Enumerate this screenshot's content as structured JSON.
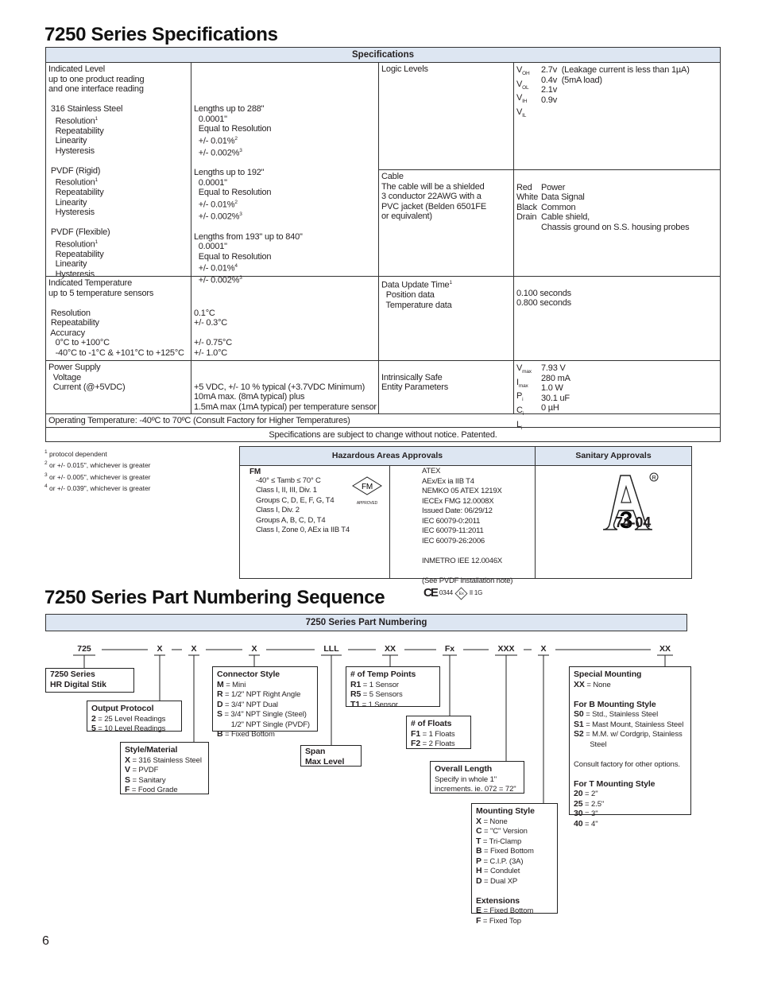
{
  "spec_title": "7250 Series Specifications",
  "spec_header": "Specifications",
  "level_label": [
    "Indicated Level",
    "up to one product reading",
    "and one interface reading",
    "",
    " 316 Stainless Steel",
    {
      "t": "   Resolution",
      "sup": "1"
    },
    "   Repeatability",
    "   Linearity",
    "   Hysteresis",
    "",
    " PVDF (Rigid)",
    {
      "t": "   Resolution",
      "sup": "1"
    },
    "   Repeatability",
    "   Linearity",
    "   Hysteresis",
    "",
    " PVDF (Flexible)",
    {
      "t": "   Resolution",
      "sup": "1"
    },
    "   Repeatability",
    "   Linearity",
    "   Hysteresis"
  ],
  "level_value": [
    "",
    "",
    "",
    "",
    "Lengths up to 288\"",
    "  0.0001\"",
    "  Equal to Resolution",
    {
      "t": "  +/- 0.01%",
      "sup": "2"
    },
    {
      "t": "  +/- 0.002%",
      "sup": "3"
    },
    "",
    "Lengths up to 192\"",
    "  0.0001\"",
    "  Equal to Resolution",
    {
      "t": "  +/- 0.01%",
      "sup": "2"
    },
    {
      "t": "  +/- 0.002%",
      "sup": "3"
    },
    "",
    "Lengths from 193\" up to 840\"",
    "  0.0001\"",
    "  Equal to Resolution",
    {
      "t": "  +/- 0.01%",
      "sup": "4"
    },
    {
      "t": "  +/- 0.002%",
      "sup": "3"
    }
  ],
  "temp_label": [
    "Indicated Temperature",
    "up to 5 temperature sensors",
    "",
    " Resolution",
    " Repeatability",
    " Accuracy",
    "   0°C to +100°C",
    "   -40°C to -1°C & +101°C to +125°C"
  ],
  "temp_value": [
    "",
    "",
    "",
    "0.1°C",
    "+/- 0.3°C",
    "",
    "+/- 0.75°C",
    "+/- 1.0°C"
  ],
  "power_label": [
    "Power Supply",
    "  Voltage",
    "  Current (@+5VDC)"
  ],
  "power_value": [
    "",
    "+5 VDC, +/- 10 % typical (+3.7VDC Minimum)",
    "10mA max. (8mA typical) plus",
    "1.5mA max (1mA typical) per temperature sensor"
  ],
  "logic_label": [
    "Logic Levels"
  ],
  "logic_sym": [
    {
      "t": "V",
      "sub": "OH"
    },
    {
      "t": "V",
      "sub": "OL"
    },
    {
      "t": "V",
      "sub": "IH"
    },
    {
      "t": "V",
      "sub": "IL"
    }
  ],
  "logic_value": [
    "2.7v  (Leakage current is less than 1µA)",
    "0.4v  (5mA load)",
    "2.1v",
    "0.9v"
  ],
  "cable_label": [
    "Cable",
    "The cable will be a shielded",
    "3 conductor 22AWG with a",
    "PVC jacket (Belden 6501FE",
    "or equivalent)"
  ],
  "cable_color": [
    "",
    "Red",
    "White",
    "Black",
    "Drain"
  ],
  "cable_value": [
    "",
    "Power",
    "Data Signal",
    "Common",
    "Cable shield,",
    "Chassis ground on S.S. housing probes"
  ],
  "update_label": [
    {
      "t": "Data Update Time",
      "sup": "1"
    },
    "  Position data",
    "  Temperature data"
  ],
  "update_value": [
    "",
    "0.100 seconds",
    "0.800 seconds"
  ],
  "is_label": [
    "",
    "Intrinsically Safe",
    "Entity Parameters"
  ],
  "is_sym": [
    {
      "t": "V",
      "sub": "max"
    },
    {
      "t": "I",
      "sub": "max"
    },
    {
      "t": "P",
      "sub": "i"
    },
    {
      "t": "C",
      "sub": "i"
    },
    {
      "t": "L",
      "sub": "i"
    }
  ],
  "is_value": [
    "7.93 V",
    "280 mA",
    "1.0 W",
    "30.1 uF",
    "0 µH"
  ],
  "operating_temp": "Operating Temperature: -40ºC  to 70ºC (Consult Factory for Higher Temperatures)",
  "notice": "Specifications are subject to change without notice. Patented.",
  "footnotes": [
    {
      "t": "protocol dependent",
      "n": "1"
    },
    {
      "t": "or +/- 0.015\", whichever is greater",
      "n": "2"
    },
    {
      "t": "or +/- 0.005\", whichever is greater",
      "n": "3"
    },
    {
      "t": "or +/- 0.039\", whichever is greater",
      "n": "4"
    }
  ],
  "approvals": {
    "hazardous_header": "Hazardous Areas Approvals",
    "sanitary_header": "Sanitary Approvals",
    "fm_title": "FM",
    "fm_lines": [
      "-40° ≤ Tamb ≤ 70° C",
      "Class I, II, III, Div. 1",
      "Groups C, D, E, F, G, T4",
      "Class I, Div. 2",
      "Groups A, B, C, D, T4",
      "Class I, Zone 0, AEx ia IIB T4"
    ],
    "fm_logo_text": "FM",
    "fm_logo_sub": "APPROVED",
    "atex_lines": [
      "ATEX",
      "AEx/Ex ia IIB T4",
      "NEMKO 05 ATEX 1219X",
      "IECEx FMG 12.0008X",
      "Issued Date: 06/29/12",
      "IEC 60079-0:2011",
      "IEC 60079-11:2011",
      "IEC 60079-26:2006",
      "",
      "INMETRO IEE 12.0046X",
      "",
      "(See PVDF installation note)"
    ],
    "ce_mark": "CE",
    "ce_number": "0344",
    "ex_mark": "Ex",
    "ex_class": "II 1G",
    "three_a_number": "74-04",
    "three_a_mark": "3"
  },
  "pn_title": "7250 Series Part Numbering Sequence",
  "pn_header": "7250 Series Part Numbering",
  "codes": [
    "725",
    "X",
    "X",
    "X",
    "LLL",
    "XX",
    "Fx",
    "XXX",
    "X",
    "XX"
  ],
  "boxes": {
    "series": [
      {
        "k": "7250 Series"
      },
      {
        "k": "HR Digital Stik"
      }
    ],
    "output": [
      {
        "k": "Output Protocol"
      },
      {
        "k": "2",
        "v": " = 25 Level Readings"
      },
      {
        "k": "5",
        "v": " = 10 Level Readings"
      }
    ],
    "style": [
      {
        "k": "Style/Material"
      },
      {
        "k": "X",
        "v": " = 316 Stainless Steel"
      },
      {
        "k": "V",
        "v": " = PVDF"
      },
      {
        "k": "S",
        "v": " = Sanitary"
      },
      {
        "k": "F",
        "v": " = Food Grade"
      }
    ],
    "connector": [
      {
        "k": "Connector Style"
      },
      {
        "k": "M",
        "v": " = Mini"
      },
      {
        "k": "R",
        "v": " = 1/2\" NPT Right Angle"
      },
      {
        "k": "D",
        "v": " = 3/4\" NPT Dual"
      },
      {
        "k": "S",
        "v": " = 3/4\" NPT Single (Steel)"
      },
      {
        "v": "       1/2\" NPT Single (PVDF)"
      },
      {
        "k": "B",
        "v": " = Fixed Bottom"
      }
    ],
    "span": [
      {
        "k": "Span"
      },
      {
        "k": "Max Level"
      }
    ],
    "temp": [
      {
        "k": "# of Temp Points"
      },
      {
        "k": "R1",
        "v": " = 1 Sensor"
      },
      {
        "k": "R5",
        "v": " = 5 Sensors"
      },
      {
        "k": "T1",
        "v": " = 1 Sensor"
      }
    ],
    "floats": [
      {
        "k": "# of Floats"
      },
      {
        "k": "F1",
        "v": " = 1 Floats"
      },
      {
        "k": "F2",
        "v": " = 2 Floats"
      }
    ],
    "length": [
      {
        "k": "Overall Length"
      },
      {
        "v": "Specify in whole 1\""
      },
      {
        "v": "increments. ie. 072 = 72\""
      }
    ],
    "mounting": [
      {
        "k": "Mounting Style"
      },
      {
        "k": "X",
        "v": " = None"
      },
      {
        "k": "C",
        "v": " = \"C\" Version"
      },
      {
        "k": "T",
        "v": " = Tri-Clamp"
      },
      {
        "k": "B",
        "v": " = Fixed Bottom"
      },
      {
        "k": "P",
        "v": " = C.I.P. (3A)"
      },
      {
        "k": "H",
        "v": " = Condulet"
      },
      {
        "k": "D",
        "v": " = Dual XP"
      },
      {
        "v": ""
      },
      {
        "k": "Extensions"
      },
      {
        "k": "E",
        "v": " = Fixed Bottom"
      },
      {
        "k": "F",
        "v": " = Fixed Top"
      }
    ],
    "special": [
      {
        "k": "Special Mounting"
      },
      {
        "k": "XX",
        "v": " = None"
      },
      {
        "v": ""
      },
      {
        "k": "For B Mounting Style"
      },
      {
        "k": "S0",
        "v": " = Std., Stainless Steel"
      },
      {
        "k": "S1",
        "v": " = Mast Mount, Stainless Steel"
      },
      {
        "k": "S2",
        "v": " = M.M. w/ Cordgrip, Stainless"
      },
      {
        "v": "        Steel"
      },
      {
        "v": ""
      },
      {
        "v": "Consult factory for other options."
      },
      {
        "v": ""
      },
      {
        "k": "For T Mounting Style"
      },
      {
        "k": "20",
        "v": " = 2\""
      },
      {
        "k": "25",
        "v": " = 2.5\""
      },
      {
        "k": "30",
        "v": " = 3\""
      },
      {
        "k": "40",
        "v": " = 4\""
      }
    ]
  },
  "page_number": "6",
  "colors": {
    "header_fill": "#dde6f2",
    "border": "#333333"
  }
}
